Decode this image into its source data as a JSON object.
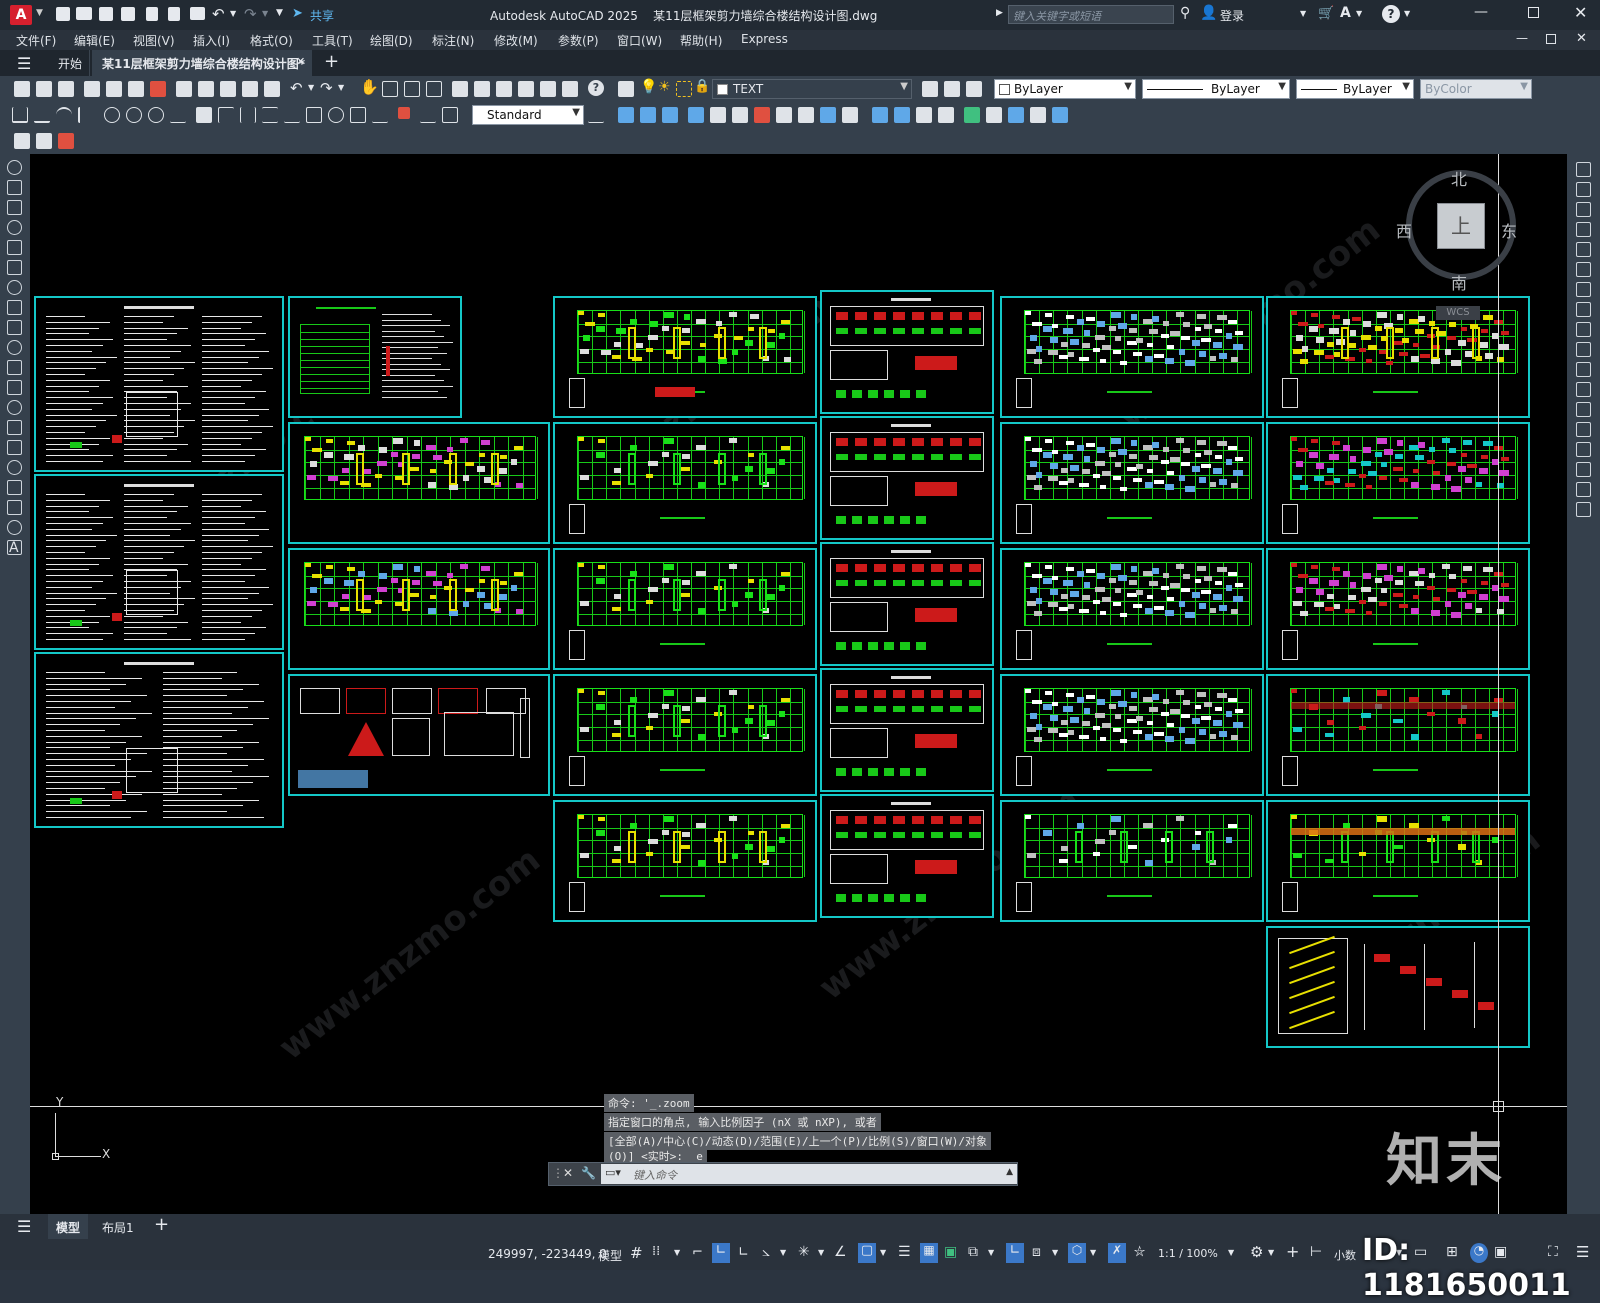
{
  "titlebar": {
    "app_icon": "A",
    "share_label": "共享",
    "title": "Autodesk AutoCAD 2025    某11层框架剪力墙综合楼结构设计图.dwg",
    "search_placeholder": "键入关键字或短语",
    "login_label": "登录"
  },
  "menu": {
    "items": [
      "文件(F)",
      "编辑(E)",
      "视图(V)",
      "插入(I)",
      "格式(O)",
      "工具(T)",
      "绘图(D)",
      "标注(N)",
      "修改(M)",
      "参数(P)",
      "窗口(W)",
      "帮助(H)",
      "Express"
    ]
  },
  "tabs": {
    "start": "开始",
    "document": "某11层框架剪力墙综合楼结构设计图*"
  },
  "toolbar": {
    "layer_name": "TEXT",
    "color": "ByLayer",
    "linetype": "ByLayer",
    "lineweight": "ByLayer",
    "plotstyle": "ByColor",
    "dimstyle": "Standard"
  },
  "viewcube": {
    "north": "北",
    "south": "南",
    "east": "东",
    "west": "西",
    "face": "上",
    "wcs": "WCS"
  },
  "ucs": {
    "x": "X",
    "y": "Y"
  },
  "command": {
    "history": [
      "命令: '_.zoom",
      "指定窗口的角点, 输入比例因子 (nX 或 nXP), 或者",
      "[全部(A)/中心(C)/动态(D)/范围(E)/上一个(P)/比例(S)/窗口(W)/对象",
      "(O)] <实时>: _e"
    ],
    "placeholder": "键入命令"
  },
  "layout_tabs": {
    "model": "模型",
    "layout1": "布局1"
  },
  "status": {
    "coords": "249997, -223449, 0",
    "model_label": "模型",
    "scale": "1:1 / 100%",
    "units": "小数"
  },
  "watermark": {
    "brand": "知末",
    "id": "ID: 1181650011",
    "site": "www.znzmo.com"
  },
  "colors": {
    "canvas": "#000000",
    "sheet_border": "#14c8c8",
    "grid_green": "#18c818",
    "accent_red": "#cc1a1a",
    "accent_yellow": "#e8e000"
  }
}
